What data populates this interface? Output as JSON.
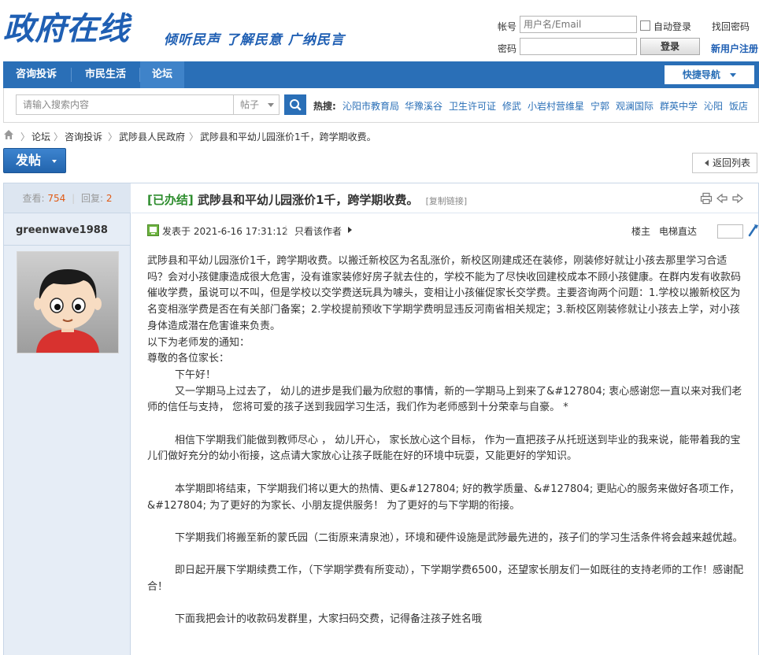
{
  "header": {
    "logo": "政府在线",
    "slogan": "倾听民声 了解民意 广纳民言",
    "login": {
      "account_label": "帐号",
      "account_placeholder": "用户名/Email",
      "password_label": "密码",
      "auto_login": "自动登录",
      "forgot": "找回密码",
      "login_button": "登录",
      "register": "新用户注册"
    }
  },
  "nav": {
    "items": [
      {
        "label": "咨询投诉"
      },
      {
        "label": "市民生活"
      },
      {
        "label": "论坛"
      }
    ],
    "quick_nav": "快捷导航"
  },
  "search": {
    "placeholder": "请输入搜索内容",
    "type": "帖子",
    "hot_label": "热搜:",
    "hot_items": [
      "沁阳市教育局",
      "华豫溪谷",
      "卫生许可证",
      "修武",
      "小岩村营维星",
      "宁郭",
      "观澜国际",
      "群英中学",
      "沁阳",
      "饭店"
    ]
  },
  "breadcrumb": [
    "论坛",
    "咨询投诉",
    "武陟县人民政府",
    "武陟县和平幼儿园涨价1千，跨学期收费。"
  ],
  "actions": {
    "post_button": "发帖",
    "back_button": "返回列表"
  },
  "thread": {
    "views_label": "查看:",
    "views": "754",
    "replies_label": "回复:",
    "replies": "2",
    "tag": "[已办结]",
    "title": "武陟县和平幼儿园涨价1千，跨学期收费。",
    "copy_link": "[复制链接]",
    "author": "greenwave1988",
    "posted_at": "发表于 2021-6-16 17:31:12",
    "only_author": "只看该作者",
    "floor": "楼主",
    "jump_label": "电梯直达",
    "content": {
      "p1": "武陟县和平幼儿园涨价1千，跨学期收费。以搬迁新校区为名乱涨价，新校区刚建成还在装修，刚装修好就让小孩去那里学习合适吗？会对小孩健康造成很大危害，没有谁家装修好房子就去住的，学校不能为了尽快收回建校成本不顾小孩健康。在群内发有收款码催收学费，虽说可以不叫，但是学校以交学费送玩具为噱头，变相让小孩催促家长交学费。主要咨询两个问题：1.学校以搬新校区为名变相涨学费是否在有关部门备案；2.学校提前预收下学期学费明显违反河南省相关规定；3.新校区刚装修就让小孩去上学，对小孩身体造成潜在危害谁来负责。",
      "p2": "以下为老师发的通知：",
      "p3": "尊敬的各位家长：",
      "p4": "下午好！",
      "p5": "又一学期马上过去了， 幼儿的进步是我们最为欣慰的事情，新的一学期马上到来了&#127804; 衷心感谢您一直以来对我们老师的信任与支持， 您将可爱的孩子送到我园学习生活，我们作为老师感到十分荣幸与自豪。 *",
      "p6": "相信下学期我们能做到教师尽心 ， 幼儿开心， 家长放心这个目标， 作为一直把孩子从托班送到毕业的我来说，能带着我的宝儿们做好充分的幼小衔接，这点请大家放心让孩子既能在好的环境中玩耍，又能更好的学知识。",
      "p7": "本学期即将结束，下学期我们将以更大的热情、更&#127804; 好的教学质量、&#127804; 更贴心的服务来做好各项工作，&#127804; 为了更好的为家长、小朋友提供服务！ 为了更好的与下学期的衔接。",
      "p8": "下学期我们将搬至新的蒙氏园（二街原来清泉池），环境和硬件设施是武陟最先进的，孩子们的学习生活条件将会越来越优越。",
      "p9": "即日起开展下学期续费工作，（下学期学费有所变动），下学期学费6500，还望家长朋友们一如既往的支持老师的工作！感谢配合！",
      "p10": "下面我把会计的收款码发群里，大家扫码交费，记得备注孩子姓名哦"
    }
  },
  "colors": {
    "brand_blue": "#2a6fb7",
    "done_green": "#2e8d2e",
    "count_orange": "#e05b16"
  }
}
